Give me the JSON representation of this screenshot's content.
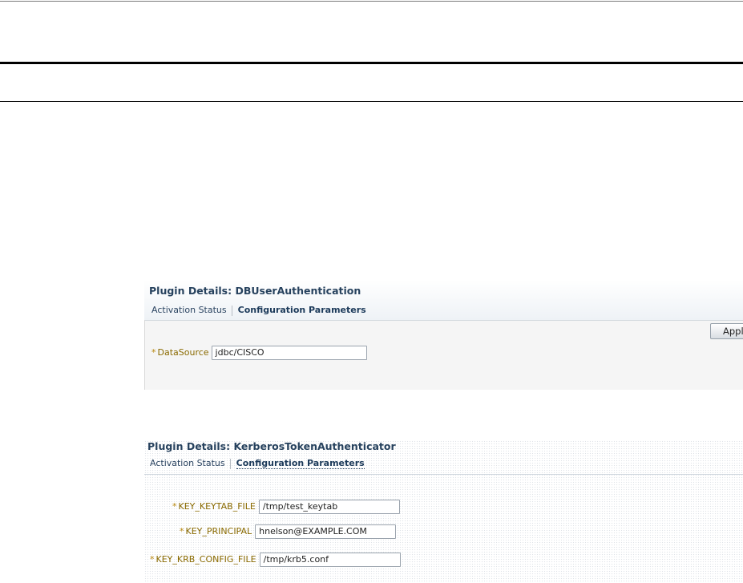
{
  "panel1": {
    "title": "Plugin Details: DBUserAuthentication",
    "tabs": [
      "Activation Status",
      "Configuration Parameters"
    ],
    "apply_label": "Apply",
    "fields": [
      {
        "required": "*",
        "label": "DataSource",
        "value": "jdbc/CISCO"
      }
    ]
  },
  "panel2": {
    "title": "Plugin Details: KerberosTokenAuthenticator",
    "tabs": [
      "Activation Status",
      "Configuration Parameters"
    ],
    "fields": [
      {
        "required": "*",
        "label": "KEY_KEYTAB_FILE",
        "value": "/tmp/test_keytab"
      },
      {
        "required": "*",
        "label": "KEY_PRINCIPAL",
        "value": "hnelson@EXAMPLE.COM"
      },
      {
        "required": "*",
        "label": "KEY_KRB_CONFIG_FILE",
        "value": "/tmp/krb5.conf"
      }
    ]
  }
}
